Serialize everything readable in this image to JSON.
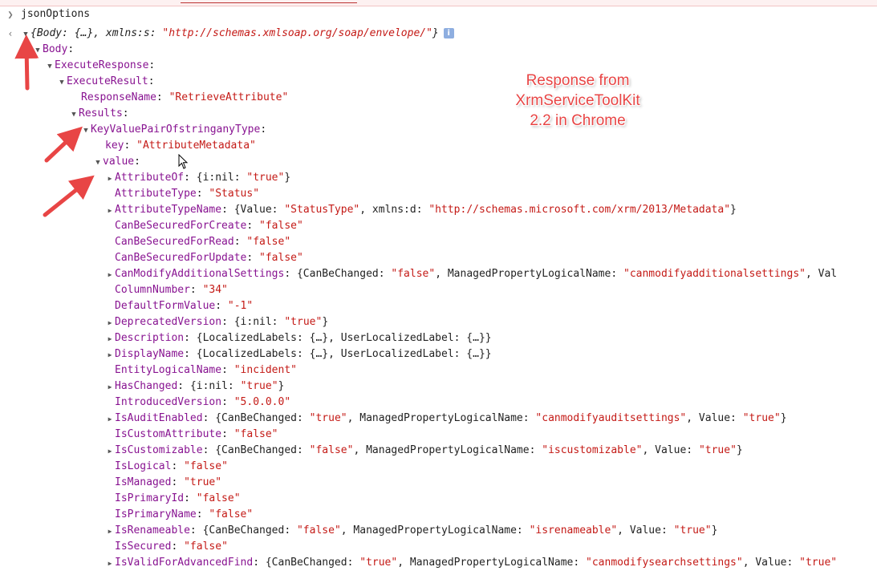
{
  "console": {
    "command": "jsonOptions",
    "root_summary": {
      "prefix": "{Body: {…}, xmlns:s: ",
      "value": "\"http://schemas.xmlsoap.org/soap/envelope/\"",
      "suffix": "}",
      "info_label": "i"
    },
    "tree": {
      "body_key": "Body",
      "execute_response_key": "ExecuteResponse",
      "execute_result_key": "ExecuteResult",
      "response_name": {
        "key": "ResponseName",
        "value": "\"RetrieveAttribute\""
      },
      "results_key": "Results",
      "kvp_key": "KeyValuePairOfstringanyType",
      "kvp_key_field": {
        "key": "key",
        "value": "\"AttributeMetadata\""
      },
      "value_key": "value",
      "properties": [
        {
          "name": "AttributeOf",
          "expandable": true,
          "segments": [
            {
              "t": "p",
              "v": "{i:nil: "
            },
            {
              "t": "s",
              "v": "\"true\""
            },
            {
              "t": "p",
              "v": "}"
            }
          ]
        },
        {
          "name": "AttributeType",
          "expandable": false,
          "segments": [
            {
              "t": "s",
              "v": "\"Status\""
            }
          ]
        },
        {
          "name": "AttributeTypeName",
          "expandable": true,
          "segments": [
            {
              "t": "p",
              "v": "{Value: "
            },
            {
              "t": "s",
              "v": "\"StatusType\""
            },
            {
              "t": "p",
              "v": ", xmlns:d: "
            },
            {
              "t": "s",
              "v": "\"http://schemas.microsoft.com/xrm/2013/Metadata\""
            },
            {
              "t": "p",
              "v": "}"
            }
          ]
        },
        {
          "name": "CanBeSecuredForCreate",
          "expandable": false,
          "segments": [
            {
              "t": "s",
              "v": "\"false\""
            }
          ]
        },
        {
          "name": "CanBeSecuredForRead",
          "expandable": false,
          "segments": [
            {
              "t": "s",
              "v": "\"false\""
            }
          ]
        },
        {
          "name": "CanBeSecuredForUpdate",
          "expandable": false,
          "segments": [
            {
              "t": "s",
              "v": "\"false\""
            }
          ]
        },
        {
          "name": "CanModifyAdditionalSettings",
          "expandable": true,
          "segments": [
            {
              "t": "p",
              "v": "{CanBeChanged: "
            },
            {
              "t": "s",
              "v": "\"false\""
            },
            {
              "t": "p",
              "v": ", ManagedPropertyLogicalName: "
            },
            {
              "t": "s",
              "v": "\"canmodifyadditionalsettings\""
            },
            {
              "t": "p",
              "v": ", Val"
            }
          ]
        },
        {
          "name": "ColumnNumber",
          "expandable": false,
          "segments": [
            {
              "t": "s",
              "v": "\"34\""
            }
          ]
        },
        {
          "name": "DefaultFormValue",
          "expandable": false,
          "segments": [
            {
              "t": "s",
              "v": "\"-1\""
            }
          ]
        },
        {
          "name": "DeprecatedVersion",
          "expandable": true,
          "segments": [
            {
              "t": "p",
              "v": "{i:nil: "
            },
            {
              "t": "s",
              "v": "\"true\""
            },
            {
              "t": "p",
              "v": "}"
            }
          ]
        },
        {
          "name": "Description",
          "expandable": true,
          "segments": [
            {
              "t": "p",
              "v": "{LocalizedLabels: {…}, UserLocalizedLabel: {…}}"
            }
          ]
        },
        {
          "name": "DisplayName",
          "expandable": true,
          "segments": [
            {
              "t": "p",
              "v": "{LocalizedLabels: {…}, UserLocalizedLabel: {…}}"
            }
          ]
        },
        {
          "name": "EntityLogicalName",
          "expandable": false,
          "segments": [
            {
              "t": "s",
              "v": "\"incident\""
            }
          ]
        },
        {
          "name": "HasChanged",
          "expandable": true,
          "segments": [
            {
              "t": "p",
              "v": "{i:nil: "
            },
            {
              "t": "s",
              "v": "\"true\""
            },
            {
              "t": "p",
              "v": "}"
            }
          ]
        },
        {
          "name": "IntroducedVersion",
          "expandable": false,
          "segments": [
            {
              "t": "s",
              "v": "\"5.0.0.0\""
            }
          ]
        },
        {
          "name": "IsAuditEnabled",
          "expandable": true,
          "segments": [
            {
              "t": "p",
              "v": "{CanBeChanged: "
            },
            {
              "t": "s",
              "v": "\"true\""
            },
            {
              "t": "p",
              "v": ", ManagedPropertyLogicalName: "
            },
            {
              "t": "s",
              "v": "\"canmodifyauditsettings\""
            },
            {
              "t": "p",
              "v": ", Value: "
            },
            {
              "t": "s",
              "v": "\"true\""
            },
            {
              "t": "p",
              "v": "}"
            }
          ]
        },
        {
          "name": "IsCustomAttribute",
          "expandable": false,
          "segments": [
            {
              "t": "s",
              "v": "\"false\""
            }
          ]
        },
        {
          "name": "IsCustomizable",
          "expandable": true,
          "segments": [
            {
              "t": "p",
              "v": "{CanBeChanged: "
            },
            {
              "t": "s",
              "v": "\"false\""
            },
            {
              "t": "p",
              "v": ", ManagedPropertyLogicalName: "
            },
            {
              "t": "s",
              "v": "\"iscustomizable\""
            },
            {
              "t": "p",
              "v": ", Value: "
            },
            {
              "t": "s",
              "v": "\"true\""
            },
            {
              "t": "p",
              "v": "}"
            }
          ]
        },
        {
          "name": "IsLogical",
          "expandable": false,
          "segments": [
            {
              "t": "s",
              "v": "\"false\""
            }
          ]
        },
        {
          "name": "IsManaged",
          "expandable": false,
          "segments": [
            {
              "t": "s",
              "v": "\"true\""
            }
          ]
        },
        {
          "name": "IsPrimaryId",
          "expandable": false,
          "segments": [
            {
              "t": "s",
              "v": "\"false\""
            }
          ]
        },
        {
          "name": "IsPrimaryName",
          "expandable": false,
          "segments": [
            {
              "t": "s",
              "v": "\"false\""
            }
          ]
        },
        {
          "name": "IsRenameable",
          "expandable": true,
          "segments": [
            {
              "t": "p",
              "v": "{CanBeChanged: "
            },
            {
              "t": "s",
              "v": "\"false\""
            },
            {
              "t": "p",
              "v": ", ManagedPropertyLogicalName: "
            },
            {
              "t": "s",
              "v": "\"isrenameable\""
            },
            {
              "t": "p",
              "v": ", Value: "
            },
            {
              "t": "s",
              "v": "\"true\""
            },
            {
              "t": "p",
              "v": "}"
            }
          ]
        },
        {
          "name": "IsSecured",
          "expandable": false,
          "segments": [
            {
              "t": "s",
              "v": "\"false\""
            }
          ]
        },
        {
          "name": "IsValidForAdvancedFind",
          "expandable": true,
          "segments": [
            {
              "t": "p",
              "v": "{CanBeChanged: "
            },
            {
              "t": "s",
              "v": "\"true\""
            },
            {
              "t": "p",
              "v": ", ManagedPropertyLogicalName: "
            },
            {
              "t": "s",
              "v": "\"canmodifysearchsettings\""
            },
            {
              "t": "p",
              "v": ", Value: "
            },
            {
              "t": "s",
              "v": "\"true\""
            }
          ]
        }
      ]
    }
  },
  "annotation": {
    "lines": [
      "Response from",
      "XrmServiceToolKit",
      "2.2 in Chrome"
    ],
    "color": "#e84545"
  },
  "colors": {
    "key": "#881391",
    "string": "#c41a16",
    "arrow": "#e84545"
  }
}
